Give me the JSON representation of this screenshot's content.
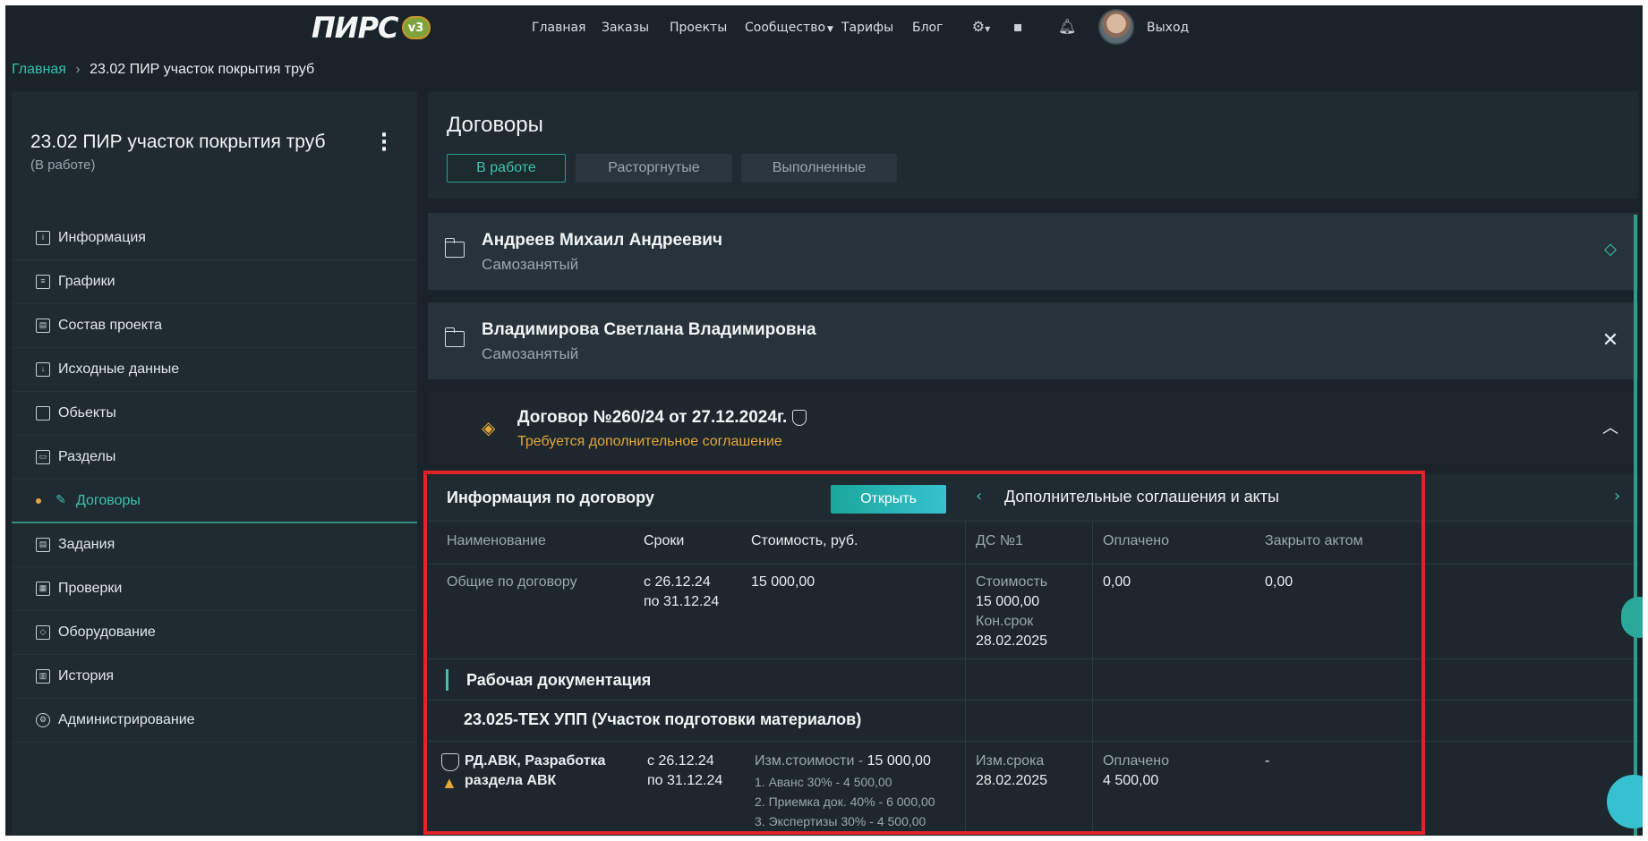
{
  "brand": {
    "logo_text": "ПИРС",
    "version_badge": "v3"
  },
  "nav": {
    "items": [
      "Главная",
      "Заказы",
      "Проекты",
      "Сообщество",
      "Тарифы",
      "Блог"
    ],
    "logout": "Выход",
    "icons": [
      "gear-icon",
      "chat-icon",
      "bell-icon"
    ]
  },
  "breadcrumb": {
    "home": "Главная",
    "current": "23.02  ПИР участок покрытия труб"
  },
  "project": {
    "title": "23.02  ПИР участок покрытия труб",
    "status": "(В работе)"
  },
  "sidebar": {
    "items": [
      {
        "label": "Информация",
        "icon": "info-icon"
      },
      {
        "label": "Графики",
        "icon": "chart-icon"
      },
      {
        "label": "Состав проекта",
        "icon": "list-icon"
      },
      {
        "label": "Исходные данные",
        "icon": "download-icon"
      },
      {
        "label": "Обьекты",
        "icon": "box-icon"
      },
      {
        "label": "Разделы",
        "icon": "sections-icon"
      },
      {
        "label": "Договоры",
        "icon": "pen-icon"
      },
      {
        "label": "Задания",
        "icon": "tasks-icon"
      },
      {
        "label": "Проверки",
        "icon": "check-icon"
      },
      {
        "label": "Оборудование",
        "icon": "equipment-icon"
      },
      {
        "label": "История",
        "icon": "history-icon"
      },
      {
        "label": "Администрирование",
        "icon": "settings-icon"
      }
    ],
    "active_index": 6
  },
  "contracts": {
    "title": "Договоры",
    "tabs": [
      "В работе",
      "Расторгнутые",
      "Выполненные"
    ],
    "persons": [
      {
        "name": "Андреев Михаил Андреевич",
        "type": "Самозанятый"
      },
      {
        "name": "Владимирова  Светлана Владимировна",
        "type": "Самозанятый"
      }
    ],
    "contract": {
      "name": "Договор №260/24 от 27.12.2024г.",
      "warning": "Требуется дополнительное соглашение"
    }
  },
  "details": {
    "title": "Информация по договору",
    "open_button": "Открыть",
    "right_title": "Дополнительные соглашения и акты",
    "headers": [
      "Наименование",
      "Сроки",
      "Стоимость, руб.",
      "ДС №1",
      "Оплачено",
      "Закрыто актом"
    ],
    "general_row": {
      "name": "Общие по договору",
      "dates_1": "с 26.12.24",
      "dates_2": "по 31.12.24",
      "cost": "15 000,00",
      "ds_cost_label": "Стоимость",
      "ds_cost": "15 000,00",
      "ds_end_label": "Кон.срок",
      "ds_end": "28.02.2025",
      "paid": "0,00",
      "closed": "0,00"
    },
    "section": "Рабочая документация",
    "subsection": "23.025-ТЕХ УПП (Участок подготовки материалов)",
    "item_row": {
      "name_1": "РД.АВК, Разработка",
      "name_2": "раздела АВК",
      "dates_1": "с 26.12.24",
      "dates_2": "по 31.12.24",
      "cost_label": "Изм.стоимости - ",
      "cost_value": "15 000,00",
      "stages": [
        "1. Аванс 30% - 4 500,00",
        "2. Приемка док. 40% - 6 000,00",
        "3. Экспертизы 30% - 4 500,00"
      ],
      "ds_label": "Изм.срока",
      "ds_value": "28.02.2025",
      "paid_label": "Оплачено",
      "paid_value": "4 500,00",
      "closed": "-"
    }
  },
  "colors": {
    "accent": "#3fc1ad",
    "warning": "#e5a73a",
    "highlight": "#e0242a",
    "background": "#1a2329"
  }
}
